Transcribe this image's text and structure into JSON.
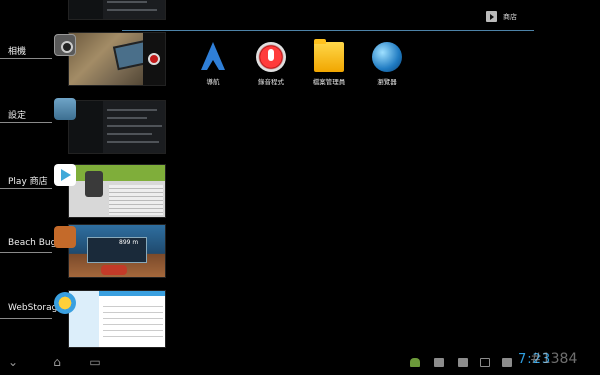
{
  "recent_apps": [
    {
      "label": "相機"
    },
    {
      "label": "設定"
    },
    {
      "label": "Play 商店"
    },
    {
      "label": "Beach Bugg"
    },
    {
      "label": "WebStorage"
    }
  ],
  "thumbnails": {
    "buggy_score": "899 m"
  },
  "home": {
    "store_label": "商店",
    "shortcuts": [
      {
        "label": "導航",
        "icon": "navigation-icon"
      },
      {
        "label": "錄音程式",
        "icon": "sound-recorder-icon"
      },
      {
        "label": "檔案管理員",
        "icon": "file-manager-icon"
      },
      {
        "label": "瀏覽器",
        "icon": "browser-icon"
      }
    ]
  },
  "status_bar": {
    "time": "7:23",
    "watermark": "#1384"
  },
  "colors": {
    "accent": "#2f9fe0",
    "divider": "#4d83a8"
  }
}
